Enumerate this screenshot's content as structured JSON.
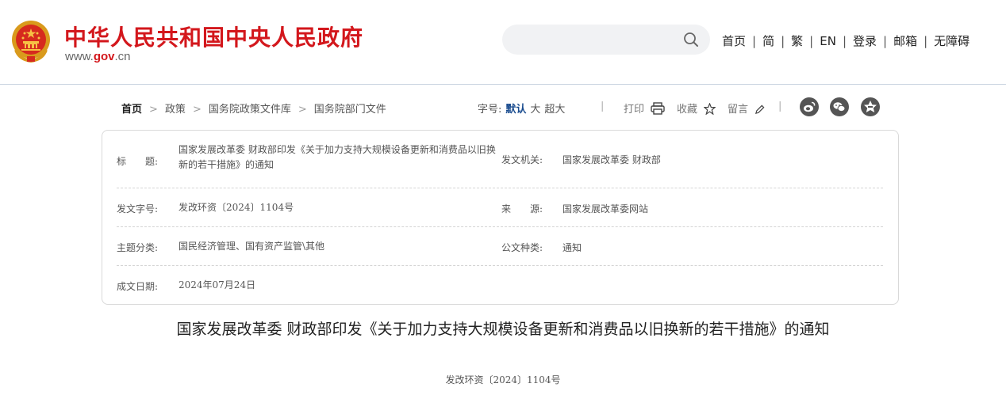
{
  "header": {
    "site_name": "中华人民共和国中央人民政府",
    "site_url_prefix": "www.",
    "site_url_brand": "gov",
    "site_url_suffix": ".cn",
    "search_placeholder": "",
    "nav": [
      "首页",
      "简",
      "繁",
      "EN",
      "登录",
      "邮箱",
      "无障碍"
    ],
    "nav_separator": "|",
    "brand_color": "#d3171c"
  },
  "breadcrumb": [
    "首页",
    "政策",
    "国务院政策文件库",
    "国务院部门文件"
  ],
  "breadcrumb_separator": ">",
  "toolbar": {
    "font_size_label": "字号:",
    "font_sizes": [
      "默认",
      "大",
      "超大"
    ],
    "active_font_size": "默认",
    "divider": "|",
    "print_label": "打印",
    "favorite_label": "收藏",
    "comment_label": "留言",
    "share_icons": [
      "weibo-icon",
      "wechat-icon",
      "qzone-icon"
    ]
  },
  "info": {
    "title_label": "标　　题:",
    "title_value": "国家发展改革委 财政部印发《关于加力支持大规模设备更新和消费品以旧换新的若干措施》的通知",
    "issuer_label": "发文机关:",
    "issuer_value": "国家发展改革委 财政部",
    "doc_no_label": "发文字号:",
    "doc_no_value": "发改环资〔2024〕1104号",
    "source_label": "来　　源:",
    "source_value": "国家发展改革委网站",
    "category_label": "主题分类:",
    "category_value": "国民经济管理、国有资产监管\\其他",
    "doc_type_label": "公文种类:",
    "doc_type_value": "通知",
    "date_label": "成文日期:",
    "date_value": "2024年07月24日"
  },
  "article": {
    "title": "国家发展改革委 财政部印发《关于加力支持大规模设备更新和消费品以旧换新的若干措施》的通知",
    "doc_no": "发改环资〔2024〕1104号"
  }
}
